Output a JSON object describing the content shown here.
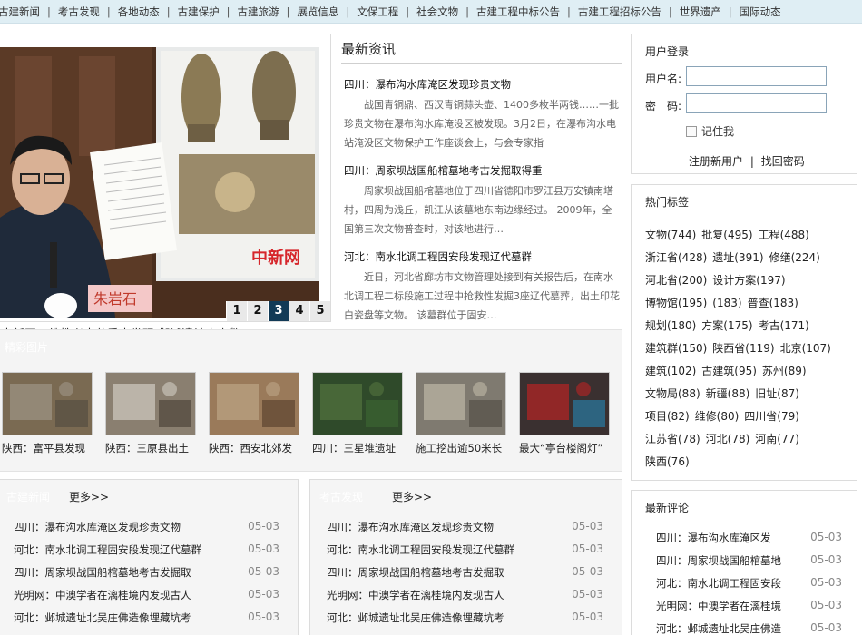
{
  "nav": [
    "古建新闻",
    "考古发现",
    "各地动态",
    "古建保护",
    "古建旅游",
    "展览信息",
    "文保工程",
    "社会文物",
    "古建工程中标公告",
    "古建工程招标公告",
    "世界遗产",
    "国际动态"
  ],
  "hero": {
    "caption": "中新网：佛教考古获重大发现 邺城遗址出土数",
    "pages": [
      "1",
      "2",
      "3",
      "4",
      "5"
    ],
    "active_page": "3",
    "watermark": "中新网",
    "name_tag": "朱岩石"
  },
  "news": {
    "title": "最新资讯",
    "items": [
      {
        "title": "四川：瀑布沟水库淹区发现珍贵文物",
        "summary": "战国青铜鼎、西汉青铜蒜头壶、1400多枚半两钱……一批珍贵文物在瀑布沟水库淹没区被发现。3月2日，在瀑布沟水电站淹没区文物保护工作座谈会上，与会专家指"
      },
      {
        "title": "四川：周家坝战国船棺墓地考古发掘取得重",
        "summary": "周家坝战国船棺墓地位于四川省德阳市罗江县万安镇南塔村，四周为浅丘，凯江从该墓地东南边缘经过。 2009年，全国第三次文物普查时，对该地进行…"
      },
      {
        "title": "河北：南水北调工程固安段发现辽代墓群",
        "summary": "近日，河北省廊坊市文物管理处接到有关报告后，在南水北调工程二标段施工过程中抢救性发掘3座辽代墓葬，出土印花白瓷盘等文物。 该墓群位于固安…"
      }
    ]
  },
  "strip": {
    "title": "精彩图片",
    "items": [
      "陕西：富平县发现",
      "陕西：三原县出土",
      "陕西：西安北郊发",
      "四川：三星堆遗址",
      "施工挖出逾50米长",
      "最大“亭台楼阁灯”"
    ]
  },
  "list_left": {
    "title": "古建新闻",
    "more": "更多>>",
    "items": [
      {
        "t": "四川：瀑布沟水库淹区发现珍贵文物",
        "d": "05-03"
      },
      {
        "t": "河北：南水北调工程固安段发现辽代墓群",
        "d": "05-03"
      },
      {
        "t": "四川：周家坝战国船棺墓地考古发掘取",
        "d": "05-03"
      },
      {
        "t": "光明网：中澳学者在漓桂境内发现古人",
        "d": "05-03"
      },
      {
        "t": "河北：邺城遗址北吴庄佛造像埋藏坑考",
        "d": "05-03"
      }
    ]
  },
  "list_right": {
    "title": "考古发现",
    "more": "更多>>",
    "items": [
      {
        "t": "四川：瀑布沟水库淹区发现珍贵文物",
        "d": "05-03"
      },
      {
        "t": "河北：南水北调工程固安段发现辽代墓群",
        "d": "05-03"
      },
      {
        "t": "四川：周家坝战国船棺墓地考古发掘取",
        "d": "05-03"
      },
      {
        "t": "光明网：中澳学者在漓桂境内发现古人",
        "d": "05-03"
      },
      {
        "t": "河北：邺城遗址北吴庄佛造像埋藏坑考",
        "d": "05-03"
      }
    ]
  },
  "login": {
    "title": "用户登录",
    "username_label": "用户名:",
    "password_label": "密　码:",
    "remember": "记住我",
    "register": "注册新用户",
    "divider": "|",
    "forgot": "找回密码"
  },
  "tags": {
    "title": "热门标签",
    "items": [
      "文物(744)",
      "批复(495)",
      "工程(488)",
      "浙江省(428)",
      "遗址(391)",
      "修缮(224)",
      "河北省(200)",
      "设计方案(197)",
      "博物馆(195)",
      "(183)",
      "普查(183)",
      "规划(180)",
      "方案(175)",
      "考古(171)",
      "建筑群(150)",
      "陕西省(119)",
      "北京(107)",
      "建筑(102)",
      "古建筑(95)",
      "苏州(89)",
      "文物局(88)",
      "新疆(88)",
      "旧址(87)",
      "项目(82)",
      "维修(80)",
      "四川省(79)",
      "江苏省(78)",
      "河北(78)",
      "河南(77)",
      "陕西(76)"
    ]
  },
  "comments": {
    "title": "最新评论",
    "items": [
      {
        "t": "四川：瀑布沟水库淹区发",
        "d": "05-03"
      },
      {
        "t": "四川：周家坝战国船棺墓地",
        "d": "05-03"
      },
      {
        "t": "河北：南水北调工程固安段",
        "d": "05-03"
      },
      {
        "t": "光明网：中澳学者在漓桂境",
        "d": "05-03"
      },
      {
        "t": "河北：邺城遗址北吴庄佛造",
        "d": "05-03"
      }
    ]
  }
}
